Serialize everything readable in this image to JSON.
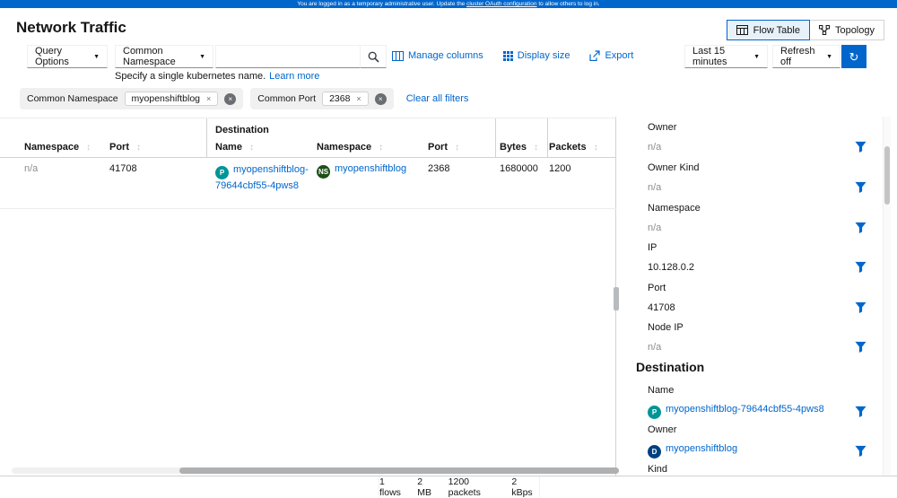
{
  "banner": {
    "text_before": "You are logged in as a temporary administrative user. Update the ",
    "link_text": "cluster OAuth configuration",
    "text_after": " to allow others to log in."
  },
  "header": {
    "title": "Network Traffic",
    "view_toggle": [
      {
        "label": "Flow Table",
        "selected": true
      },
      {
        "label": "Topology",
        "selected": false
      }
    ]
  },
  "toolbar": {
    "query_options_label": "Query Options",
    "filter_category_label": "Common Namespace",
    "search_value": "",
    "helper_text": "Specify a single kubernetes name.",
    "learn_more_label": "Learn more",
    "manage_columns_label": "Manage columns",
    "display_size_label": "Display size",
    "export_label": "Export",
    "time_range_label": "Last 15 minutes",
    "refresh_label": "Refresh off"
  },
  "filters": {
    "groups": [
      {
        "category": "Common Namespace",
        "chip": "myopenshiftblog"
      },
      {
        "category": "Common Port",
        "chip": "2368"
      }
    ],
    "clear_all_label": "Clear all filters"
  },
  "table": {
    "group_label": "Destination",
    "columns": [
      "Namespace",
      "Port",
      "Name",
      "Namespace",
      "Port",
      "Bytes",
      "Packets"
    ],
    "row": {
      "src_namespace": "n/a",
      "src_port": "41708",
      "dst_name": "myopenshiftblog-79644cbf55-4pws8",
      "dst_name_badge": "P",
      "dst_namespace": "myopenshiftblog",
      "dst_namespace_badge": "NS",
      "dst_port": "2368",
      "bytes": "1680000",
      "packets": "1200"
    }
  },
  "side_panel": {
    "fields": [
      {
        "label": "Owner",
        "value": "n/a"
      },
      {
        "label": "Owner Kind",
        "value": "n/a"
      },
      {
        "label": "Namespace",
        "value": "n/a"
      },
      {
        "label": "IP",
        "value": "10.128.0.2"
      },
      {
        "label": "Port",
        "value": "41708"
      },
      {
        "label": "Node IP",
        "value": "n/a"
      }
    ],
    "destination": {
      "title": "Destination",
      "name_label": "Name",
      "name_value": "myopenshiftblog-79644cbf55-4pws8",
      "name_badge": "P",
      "owner_label": "Owner",
      "owner_value": "myopenshiftblog",
      "owner_badge": "D",
      "kind_label": "Kind"
    }
  },
  "footer": {
    "stats": [
      "1 flows",
      "2 MB",
      "1200 packets",
      "2 kBps"
    ]
  },
  "glyphs": {
    "caret": "▼",
    "sync": "↻",
    "sort": "↕",
    "close": "×"
  },
  "colors": {
    "accent": "#0066cc",
    "banner_bg": "#0066cc",
    "pod_badge": "#009596",
    "namespace_badge": "#1e4f18",
    "deployment_badge": "#004080",
    "muted_text": "#8a8d90"
  }
}
